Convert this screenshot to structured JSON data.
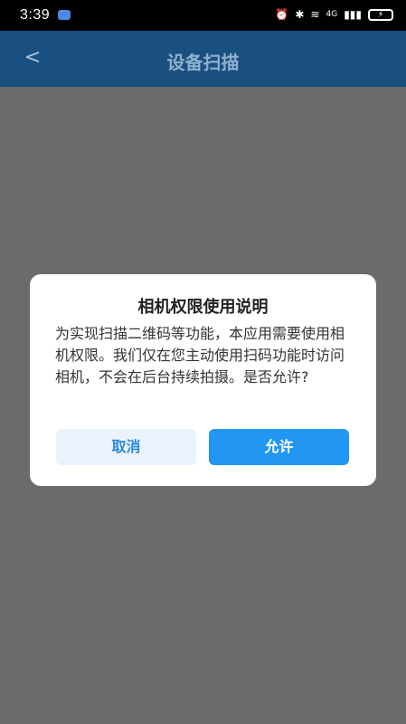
{
  "status_bar": {
    "time": "3:39",
    "icons": {
      "alarm": "⏰",
      "bluetooth": "✱",
      "wifi": "≋",
      "network": "4G",
      "signal": "▮▮▮",
      "battery": "⚡"
    }
  },
  "nav": {
    "back": "<",
    "title": "设备扫描"
  },
  "dialog": {
    "title": "相机权限使用说明",
    "message": "为实现扫描二维码等功能，本应用需要使用相机权限。我们仅在您主动使用扫码功能时访问相机，不会在后台持续拍摄。是否允许?",
    "cancel": "取消",
    "allow": "允许"
  },
  "colors": {
    "navbar": "#1a5080",
    "overlay": "#6b6b6b",
    "primary": "#2196f3",
    "cancel_bg": "#eaf3fd"
  }
}
